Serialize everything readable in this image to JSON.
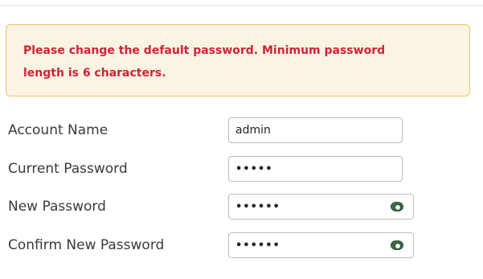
{
  "alert": {
    "message": "Please change the default password. Minimum password length is 6 characters."
  },
  "form": {
    "account_name": {
      "label": "Account Name",
      "value": "admin"
    },
    "current_password": {
      "label": "Current Password",
      "value": "•••••"
    },
    "new_password": {
      "label": "New Password",
      "value": "••••••",
      "toggle_icon": "eye-icon"
    },
    "confirm_password": {
      "label": "Confirm New Password",
      "value": "••••••",
      "toggle_icon": "eye-icon"
    }
  },
  "colors": {
    "alert_text": "#d0223a",
    "alert_background": "#fcf4e3",
    "alert_border": "#f0c26a",
    "eye_icon": "#3e6b49"
  }
}
